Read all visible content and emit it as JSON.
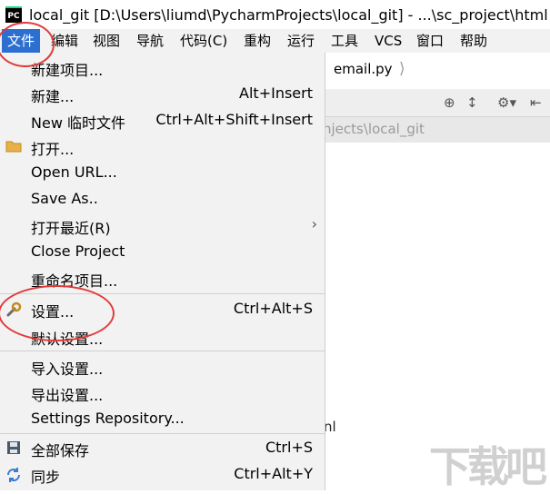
{
  "window": {
    "app_icon_text": "PC",
    "title": "local_git [D:\\Users\\liumd\\PycharmProjects\\local_git] - ...\\sc_project\\html"
  },
  "menubar": {
    "items": [
      {
        "label": "文件",
        "active": true
      },
      {
        "label": "编辑"
      },
      {
        "label": "视图"
      },
      {
        "label": "导航"
      },
      {
        "label": "代码(C)"
      },
      {
        "label": "重构"
      },
      {
        "label": "运行"
      },
      {
        "label": "工具"
      },
      {
        "label": "VCS"
      },
      {
        "label": "窗口"
      },
      {
        "label": "帮助"
      }
    ]
  },
  "editor": {
    "breadcrumb": "email.py",
    "path_fragment": "njects\\local_git",
    "side_fragment": "nl"
  },
  "file_menu": {
    "items": [
      {
        "label": "新建项目...",
        "shortcut": "",
        "icon": ""
      },
      {
        "label": "新建...",
        "shortcut": "Alt+Insert",
        "icon": ""
      },
      {
        "label": "New 临时文件",
        "shortcut": "Ctrl+Alt+Shift+Insert",
        "icon": ""
      },
      {
        "label": "打开...",
        "shortcut": "",
        "icon": "folder-icon"
      },
      {
        "label": "Open URL...",
        "shortcut": "",
        "icon": ""
      },
      {
        "label": "Save As..",
        "shortcut": "",
        "icon": ""
      },
      {
        "label": "打开最近(R)",
        "shortcut": "",
        "icon": "",
        "submenu": true
      },
      {
        "label": "Close Project",
        "shortcut": "",
        "icon": ""
      },
      {
        "label": "重命名项目...",
        "shortcut": "",
        "icon": ""
      },
      {
        "label": "设置...",
        "shortcut": "Ctrl+Alt+S",
        "icon": "wrench-icon"
      },
      {
        "label": "默认设置...",
        "shortcut": "",
        "icon": ""
      },
      {
        "label": "导入设置...",
        "shortcut": "",
        "icon": ""
      },
      {
        "label": "导出设置...",
        "shortcut": "",
        "icon": ""
      },
      {
        "label": "Settings Repository...",
        "shortcut": "",
        "icon": ""
      },
      {
        "label": "全部保存",
        "shortcut": "Ctrl+S",
        "icon": "save-icon"
      },
      {
        "label": "同步",
        "shortcut": "Ctrl+Alt+Y",
        "icon": "sync-icon"
      }
    ]
  },
  "colors": {
    "menu_active": "#2c6fd1",
    "annotation_red": "#e23a3a",
    "menu_bg": "#f2f2f2"
  }
}
